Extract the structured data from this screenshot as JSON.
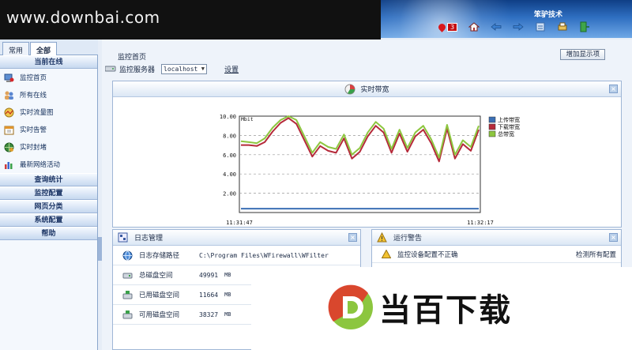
{
  "watermark_text": "www.downbai.com",
  "brand": "笨驴技术",
  "alert_count": "3",
  "tabs": [
    "常用",
    "全部"
  ],
  "sidebar": {
    "online_header": "当前在线",
    "items": [
      {
        "label": "监控首页",
        "icon": "computer-icon"
      },
      {
        "label": "所有在线",
        "icon": "users-icon"
      },
      {
        "label": "实时流量图",
        "icon": "traffic-icon"
      },
      {
        "label": "实时告警",
        "icon": "calendar-alert-icon"
      },
      {
        "label": "实时封堵",
        "icon": "globe-block-icon"
      },
      {
        "label": "最新网络活动",
        "icon": "bar-chart-icon"
      }
    ],
    "sections": [
      "查询统计",
      "监控配置",
      "网页分类",
      "系统配置",
      "帮助"
    ]
  },
  "main": {
    "breadcrumb": "监控首页",
    "server_label": "监控服务器",
    "server_value": "localhost",
    "settings_link": "设置",
    "add_display_button": "增加显示项"
  },
  "chart_panel": {
    "title": "实时带宽"
  },
  "chart_data": {
    "type": "line",
    "ylabel": "Mbit",
    "ylim": [
      0,
      10
    ],
    "yticks": [
      "2.00",
      "4.00",
      "6.00",
      "8.00",
      "10.00"
    ],
    "x_start_label": "11:31:47",
    "x_end_label": "11:32:17",
    "legend_position": "right",
    "series": [
      {
        "name": "上传带宽",
        "color": "#3b6fb5",
        "values": [
          0.4,
          0.4,
          0.4,
          0.4,
          0.4,
          0.4,
          0.4,
          0.4,
          0.4,
          0.4,
          0.4,
          0.4,
          0.4,
          0.4,
          0.4,
          0.4,
          0.4,
          0.4,
          0.4,
          0.4,
          0.4,
          0.4,
          0.4,
          0.4,
          0.4,
          0.4,
          0.4,
          0.4,
          0.4,
          0.4,
          0.4
        ]
      },
      {
        "name": "下载带宽",
        "color": "#b52a3a",
        "values": [
          7.0,
          7.0,
          6.9,
          7.3,
          8.4,
          9.3,
          9.8,
          9.2,
          7.5,
          5.8,
          6.9,
          6.4,
          6.2,
          7.7,
          5.6,
          6.3,
          7.9,
          9.0,
          8.3,
          6.2,
          8.2,
          6.3,
          7.9,
          8.6,
          7.2,
          5.3,
          8.7,
          5.6,
          7.1,
          6.4,
          8.6
        ]
      },
      {
        "name": "总带宽",
        "color": "#8dc63f",
        "values": [
          7.4,
          7.3,
          7.2,
          7.7,
          8.8,
          9.6,
          10.0,
          9.6,
          7.9,
          6.2,
          7.3,
          6.8,
          6.6,
          8.1,
          6.0,
          6.7,
          8.3,
          9.4,
          8.7,
          6.6,
          8.6,
          6.7,
          8.3,
          9.0,
          7.6,
          5.7,
          9.1,
          6.0,
          7.5,
          6.8,
          9.0
        ]
      }
    ]
  },
  "log_panel": {
    "title": "日志管理",
    "rows": [
      {
        "label": "日志存储路径",
        "value": "C:\\Program Files\\WFirewall\\WFilter",
        "unit": ""
      },
      {
        "label": "总磁盘空间",
        "value": "49991",
        "unit": "MB"
      },
      {
        "label": "已用磁盘空间",
        "value": "11664",
        "unit": "MB"
      },
      {
        "label": "可用磁盘空间",
        "value": "38327",
        "unit": "MB"
      }
    ]
  },
  "warn_panel": {
    "title": "运行警告",
    "rows": [
      {
        "label": "监控设备配置不正确",
        "action": "检测所有配置"
      }
    ]
  },
  "overlay_logo_text": "当百下载"
}
